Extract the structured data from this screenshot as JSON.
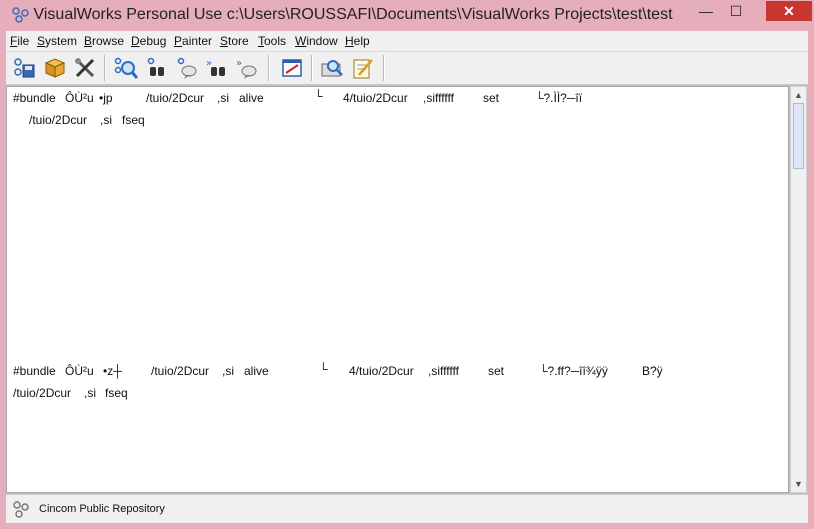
{
  "window": {
    "title": "VisualWorks Personal Use c:\\Users\\ROUSSAFI\\Documents\\VisualWorks Projects\\test\\test"
  },
  "window_buttons": {
    "minimize": "—",
    "maximize": "☐",
    "close": "✕"
  },
  "menu": [
    {
      "first": "F",
      "rest": "ile"
    },
    {
      "first": "S",
      "rest": "ystem"
    },
    {
      "first": "B",
      "rest": "rowse"
    },
    {
      "first": "D",
      "rest": "ebug"
    },
    {
      "first": "P",
      "rest": "ainter"
    },
    {
      "first": "S",
      "rest": "tore"
    },
    {
      "first": "T",
      "rest": "ools"
    },
    {
      "first": "W",
      "rest": "indow"
    },
    {
      "first": "H",
      "rest": "elp"
    }
  ],
  "toolbar_icons": [
    "save-image-icon",
    "package-icon",
    "tools-icon",
    "system-browser-icon",
    "find-class-icon",
    "find-method-icon",
    "senders-icon",
    "implementors-icon",
    "workspace-icon",
    "inspector-icon",
    "notepad-icon"
  ],
  "content": {
    "block1": {
      "line1": [
        "#bundle",
        "ÔÙ²u",
        "•jp",
        "/tuio/2Dcur",
        ",si",
        "alive",
        "└",
        "4/tuio/2Dcur",
        ",siffffff",
        "set",
        "└?.ÌÌ?─îï"
      ],
      "line2": [
        "/tuio/2Dcur",
        ",si",
        "fseq"
      ]
    },
    "block2": {
      "line1": [
        "#bundle",
        "ÔÙ²u",
        "•z┼",
        "/tuio/2Dcur",
        ",si",
        "alive",
        "└",
        "4/tuio/2Dcur",
        ",siffffff",
        "set",
        "└?.ff?─îî¾ÿÿ",
        "B?ÿ"
      ],
      "line2": [
        "/tuio/2Dcur",
        ",si",
        "fseq"
      ]
    }
  },
  "status": {
    "text": "Cincom Public Repository"
  },
  "colors": {
    "titlebar": "#e6adbb",
    "close": "#c7372f",
    "menubar": "#f0f0f0"
  }
}
